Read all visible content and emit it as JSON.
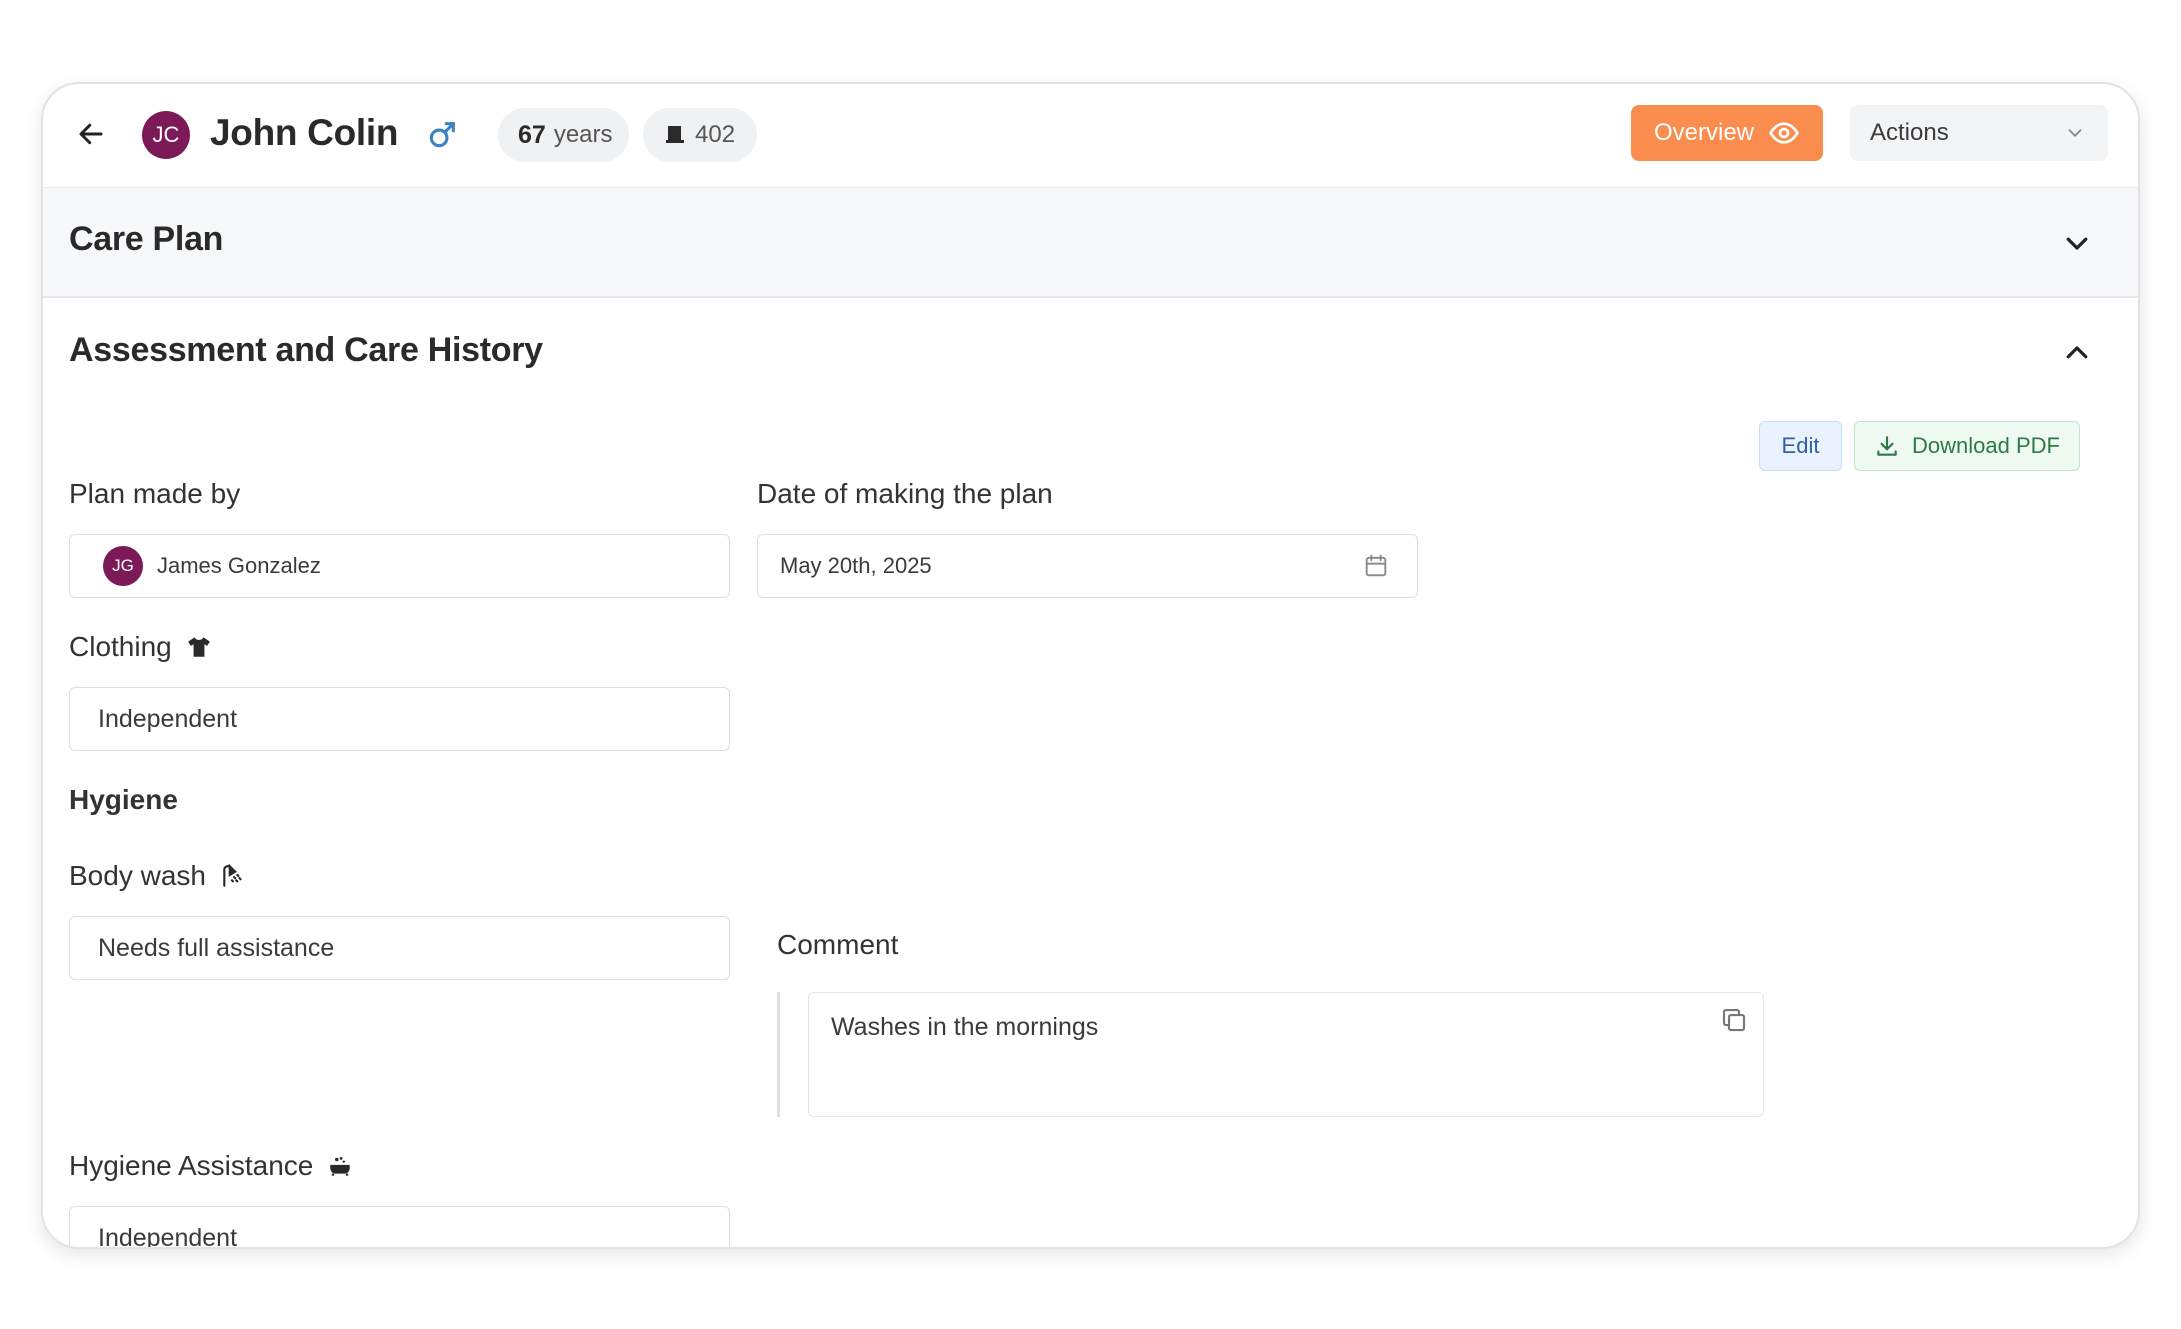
{
  "header": {
    "avatar_initials": "JC",
    "patient_name": "John Colin",
    "gender_symbol": "♂",
    "age_value": "67",
    "age_unit": "years",
    "room": "402",
    "overview_label": "Overview",
    "actions_label": "Actions",
    "colors": {
      "accent": "#fa8c4e",
      "avatar": "#7c1a57",
      "gender": "#3b82c4"
    }
  },
  "sections": {
    "care_plan_title": "Care Plan",
    "assessment_title": "Assessment and Care History"
  },
  "toolbar": {
    "edit_label": "Edit",
    "download_label": "Download PDF"
  },
  "form": {
    "plan_made_by_label": "Plan made by",
    "plan_made_by_initials": "JG",
    "plan_made_by_value": "James Gonzalez",
    "date_label": "Date of making the plan",
    "date_value": "May 20th, 2025",
    "clothing_label": "Clothing",
    "clothing_value": "Independent",
    "hygiene_heading": "Hygiene",
    "body_wash_label": "Body wash",
    "body_wash_value": "Needs full assistance",
    "comment_label": "Comment",
    "comment_value": "Washes in the mornings",
    "hygiene_assistance_label": "Hygiene Assistance",
    "hygiene_assistance_value": "Independent"
  },
  "icons": {
    "back": "arrow-left-icon",
    "gender": "male-icon",
    "room": "bed-icon",
    "overview": "eye-icon",
    "actions": "chevron-down-icon",
    "care_plan_toggle": "chevron-down-icon",
    "assessment_toggle": "chevron-up-icon",
    "download": "download-icon",
    "calendar": "calendar-icon",
    "clothing": "shirt-icon",
    "body_wash": "shower-icon",
    "hygiene_assistance": "bathtub-icon",
    "copy": "copy-icon"
  }
}
